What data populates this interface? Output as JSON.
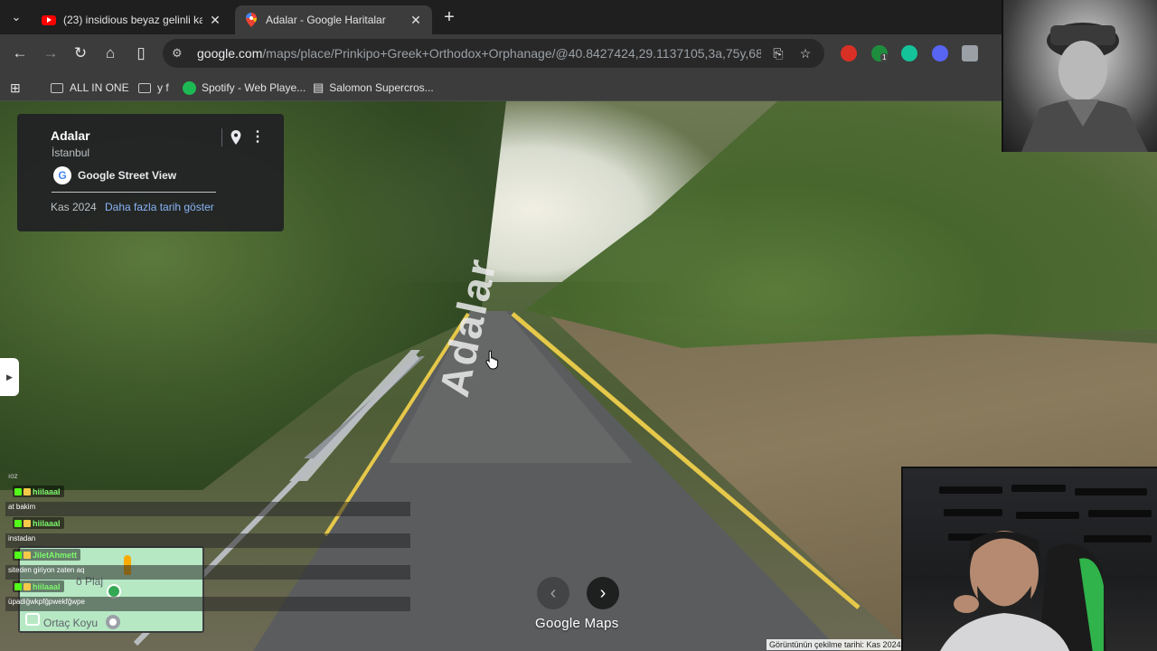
{
  "browser": {
    "tabs": [
      {
        "title": "(23) insidious beyaz gelinli kadın",
        "favicon": "youtube-icon",
        "active": false
      },
      {
        "title": "Adalar - Google Haritalar",
        "favicon": "google-maps-icon",
        "active": true
      }
    ],
    "url_host": "google.com",
    "url_path": "/maps/place/Prinkipo+Greek+Orthodox+Orphanage/@40.8427424,29.1137105,3a,75y,68.66h,...",
    "bookmarks": [
      {
        "label": "ALL IN ONE",
        "icon": "folder-icon"
      },
      {
        "label": "y f",
        "icon": "folder-icon"
      },
      {
        "label": "Spotify - Web Playe...",
        "icon": "spotify-icon"
      },
      {
        "label": "Salomon Supercros...",
        "icon": "bookmark-page-icon"
      }
    ],
    "extension_badge": "1"
  },
  "streetview": {
    "place_title": "Adalar",
    "place_subtitle": "İstanbul",
    "brand": "Google Street View",
    "date": "Kas 2024",
    "more_dates_link": "Daha fazla tarih göster",
    "road_text": "Adalar",
    "logo_google": "Google",
    "logo_maps": "Maps",
    "capture_date": "Görüntünün çekilme tarihi: Kas 2024"
  },
  "minimap": {
    "label_top": "ö Plaj",
    "label_bottom": "Ortaç Koyu"
  },
  "chat": {
    "top_fragment": "ıoz",
    "messages": [
      {
        "user": "hiilaaal",
        "text": "at bakim"
      },
      {
        "user": "hiilaaal",
        "text": "instadan"
      },
      {
        "user": "JiletAhmett",
        "text": "siteden giriyon zaten aq"
      },
      {
        "user": "hiilaaal",
        "text": "üpadiğwkpfğpwekfğwpe"
      }
    ]
  },
  "colors": {
    "chrome_bg": "#3c3c3c",
    "tabbar_bg": "#1f1f1f",
    "link_blue": "#8ab4f8",
    "minimap_green": "#b6e8c4",
    "chat_user_green": "#7df86b"
  }
}
